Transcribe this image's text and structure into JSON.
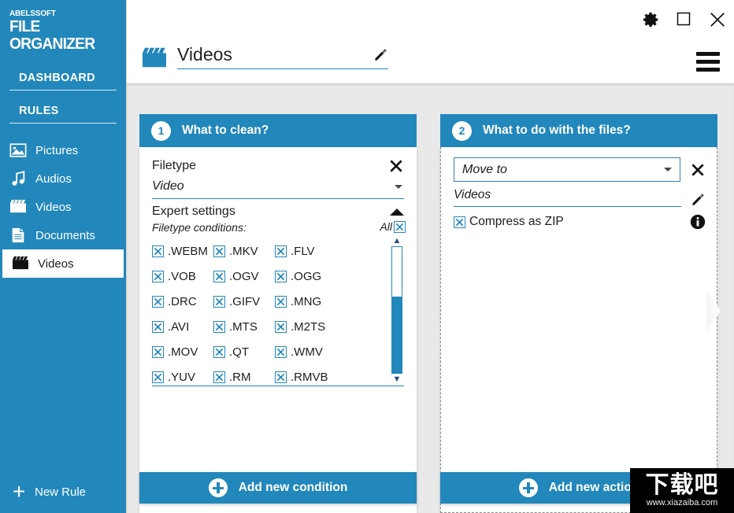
{
  "brand": {
    "company": "ABELSSOFT",
    "product": "FILE ORGANIZER"
  },
  "sidebar": {
    "headings": [
      {
        "label": "DASHBOARD"
      },
      {
        "label": "RULES"
      }
    ],
    "items": [
      {
        "label": "Pictures",
        "icon": "picture-icon",
        "selected": false
      },
      {
        "label": "Audios",
        "icon": "audio-icon",
        "selected": false
      },
      {
        "label": "Videos",
        "icon": "video-icon",
        "selected": false
      },
      {
        "label": "Documents",
        "icon": "document-icon",
        "selected": false
      },
      {
        "label": "Videos",
        "icon": "video-icon",
        "selected": true
      }
    ],
    "new_rule": {
      "label": "New Rule",
      "icon": "plus-icon"
    }
  },
  "titlebar": {
    "page_title": "Videos",
    "page_icon": "clapperboard-icon",
    "edit_icon": "pencil-icon",
    "window_controls": [
      {
        "name": "settings-gear-icon"
      },
      {
        "name": "maximize-icon"
      },
      {
        "name": "close-icon"
      }
    ],
    "menu_icon": "hamburger-menu-icon"
  },
  "panel1": {
    "step": "1",
    "title": "What to clean?",
    "filetype_label": "Filetype",
    "close_icon": "close-icon",
    "filetype_value": "Video",
    "expert_settings_label": "Expert settings",
    "expert_collapse_icon": "chevron-up-icon",
    "conditions_label": "Filetype conditions:",
    "all_label": "All",
    "all_checked": true,
    "extensions": [
      {
        "label": ".WEBM",
        "checked": true
      },
      {
        "label": ".MKV",
        "checked": true
      },
      {
        "label": ".FLV",
        "checked": true
      },
      {
        "label": ".VOB",
        "checked": true
      },
      {
        "label": ".OGV",
        "checked": true
      },
      {
        "label": ".OGG",
        "checked": true
      },
      {
        "label": ".DRC",
        "checked": true
      },
      {
        "label": ".GIFV",
        "checked": true
      },
      {
        "label": ".MNG",
        "checked": true
      },
      {
        "label": ".AVI",
        "checked": true
      },
      {
        "label": ".MTS",
        "checked": true
      },
      {
        "label": ".M2TS",
        "checked": true
      },
      {
        "label": ".MOV",
        "checked": true
      },
      {
        "label": ".QT",
        "checked": true
      },
      {
        "label": ".WMV",
        "checked": true
      },
      {
        "label": ".YUV",
        "checked": true
      },
      {
        "label": ".RM",
        "checked": true
      },
      {
        "label": ".RMVB",
        "checked": true
      }
    ],
    "add_button": {
      "label": "Add new condition",
      "icon": "plus-circle-icon"
    }
  },
  "panel2": {
    "step": "2",
    "title": "What to do with the files?",
    "action_value": "Move to",
    "close_icon": "close-icon",
    "target_value": "Videos",
    "edit_icon": "pencil-icon",
    "compress_label": "Compress as ZIP",
    "compress_checked": true,
    "info_icon": "info-icon",
    "add_button": {
      "label": "Add new action",
      "icon": "plus-circle-icon"
    }
  },
  "watermark": {
    "text_cn": "下载吧",
    "url": "www.xiazaiba.com"
  },
  "colors": {
    "brand_blue": "#2287bb",
    "content_bg": "#e9e9e9",
    "panel_bg": "#ffffff"
  }
}
